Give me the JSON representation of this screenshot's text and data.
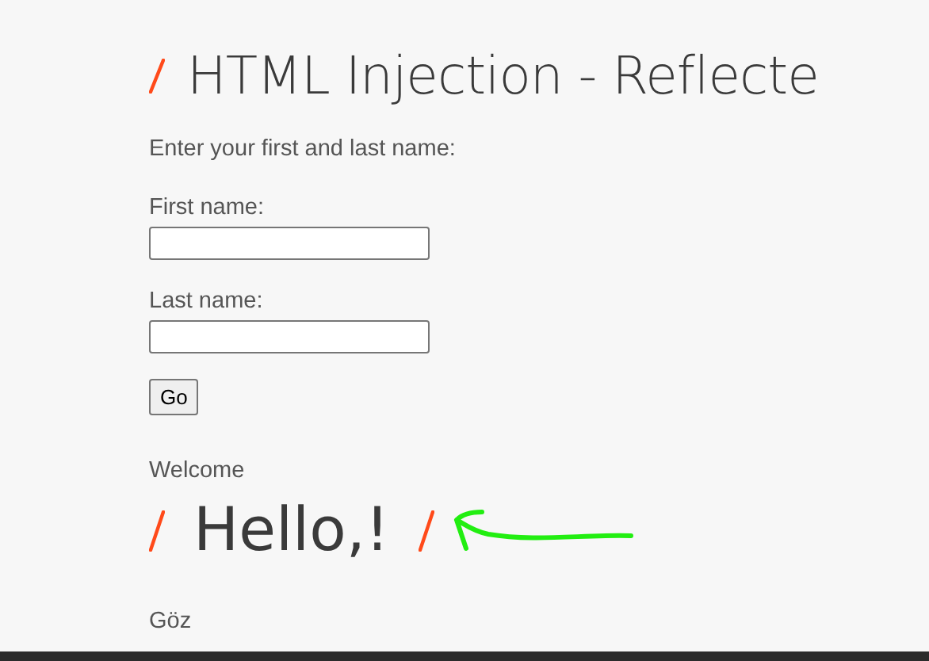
{
  "heading": {
    "text": "HTML Injection - Reflecte"
  },
  "intro": "Enter your first and last name:",
  "fields": [
    {
      "label": "First name:"
    },
    {
      "label": "Last name:"
    }
  ],
  "button": "Go",
  "welcome": "Welcome",
  "greeting": "Hello,!",
  "footer_text": "Göz"
}
